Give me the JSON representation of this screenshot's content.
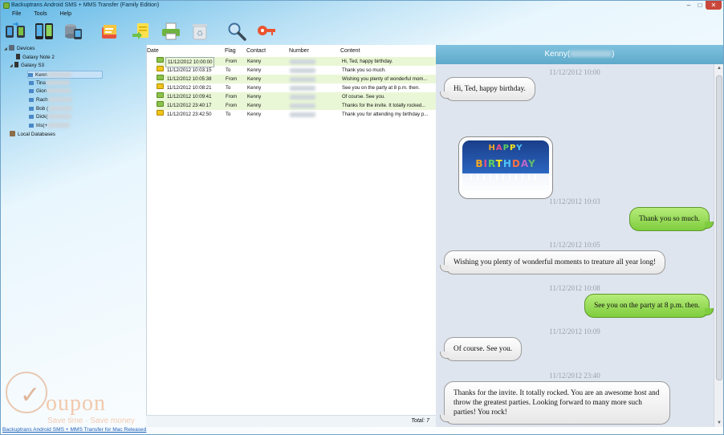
{
  "window": {
    "title": "Backuptrans Android SMS + MMS Transfer (Family Edition)",
    "controls": [
      "–",
      "□",
      "✕"
    ]
  },
  "menu": [
    "File",
    "Tools",
    "Help"
  ],
  "toolbar": [
    {
      "name": "devices-sync-icon"
    },
    {
      "name": "phone-transfer-icon"
    },
    {
      "name": "database-icon"
    },
    {
      "name": "export-icon"
    },
    {
      "name": "import-icon"
    },
    {
      "name": "print-icon"
    },
    {
      "name": "recycle-icon"
    },
    {
      "name": "search-icon"
    },
    {
      "name": "key-icon"
    }
  ],
  "tree": {
    "devices_label": "Devices",
    "device1": "Galaxy Note 2",
    "device2": "Galaxy S3",
    "contacts": [
      "Kenn",
      "Tina",
      "Gion",
      "Rach",
      "Bob (",
      "Dick(",
      "Iris(+"
    ],
    "local_db_label": "Local Databases"
  },
  "list": {
    "headers": {
      "date": "Date",
      "flag": "Flag",
      "contact": "Contact",
      "number": "Number",
      "content": "Content"
    },
    "rows": [
      {
        "date": "11/12/2012 10:00:00",
        "flag": "From",
        "contact": "Kenny",
        "content": "Hi, Ted, happy birthday."
      },
      {
        "date": "11/12/2012 10:03:15",
        "flag": "To",
        "contact": "Kenny",
        "content": "Thank you so much."
      },
      {
        "date": "11/12/2012 10:05:38",
        "flag": "From",
        "contact": "Kenny",
        "content": "Wishing you plenty of wonderful mom..."
      },
      {
        "date": "11/12/2012 10:08:21",
        "flag": "To",
        "contact": "Kenny",
        "content": "See you on the party at 8 p.m. then."
      },
      {
        "date": "11/12/2012 10:09:41",
        "flag": "From",
        "contact": "Kenny",
        "content": "Of course. See you."
      },
      {
        "date": "11/12/2012 23:40:17",
        "flag": "From",
        "contact": "Kenny",
        "content": "Thanks for the invite. It totally rocked..."
      },
      {
        "date": "11/12/2012 23:42:50",
        "flag": "To",
        "contact": "Kenny",
        "content": "Thank you for attending my birthday p..."
      }
    ],
    "total": "Total: 7"
  },
  "chat": {
    "header_name": "Kenny(",
    "header_suffix": ")",
    "image_text_top": [
      "H",
      "A",
      "P",
      "P",
      "Y"
    ],
    "image_text_bottom": [
      "B",
      "I",
      "R",
      "T",
      "H",
      "D",
      "A",
      "Y"
    ],
    "messages": [
      {
        "time": "11/12/2012 10:00",
        "dir": "in",
        "text": "Hi, Ted, happy birthday."
      },
      {
        "time": "11/12/2012 10:03",
        "dir": "out",
        "text": "Thank you so much."
      },
      {
        "time": "11/12/2012 10:05",
        "dir": "in",
        "text": "Wishing you plenty of wonderful moments to treature all year long!"
      },
      {
        "time": "11/12/2012 10:08",
        "dir": "out",
        "text": "See you on the party at 8 p.m. then."
      },
      {
        "time": "11/12/2012 10:09",
        "dir": "in",
        "text": "Of course. See you."
      },
      {
        "time": "11/12/2012 23:40",
        "dir": "in",
        "text": "Thanks for the invite. It totally rocked. You are an awesome host and throw the greatest parties. Looking forward to many more such parties! You rock!"
      }
    ]
  },
  "watermark": {
    "text": "oupon",
    "sub": "Save time · Save money"
  },
  "mac_link": "Backuptrans Android SMS + MMS Transfer for Mac Released"
}
